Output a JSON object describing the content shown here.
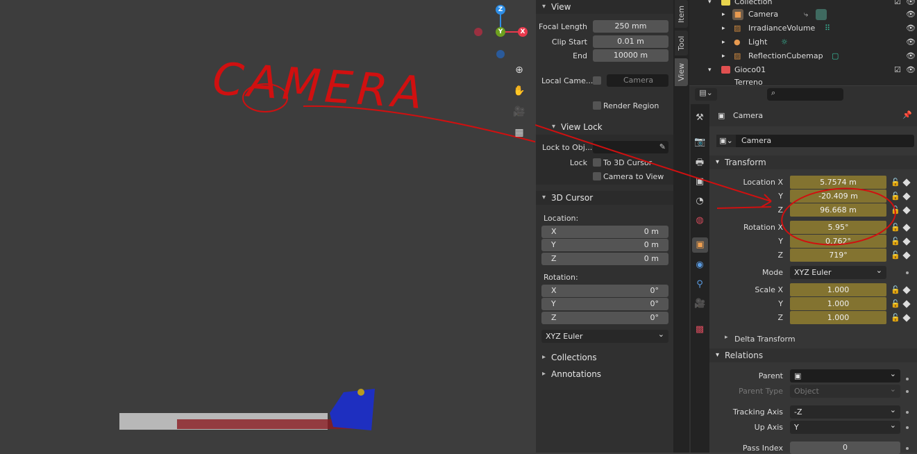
{
  "viewport": {
    "annotation_text": "CAMERA",
    "annotation_color": "#d01010",
    "axes": {
      "z": "Z",
      "y": "Y",
      "x": "X"
    },
    "colors": {
      "x": "#e8394c",
      "y": "#6ea01f",
      "z": "#2e8ee6"
    }
  },
  "npanel": {
    "tabs": [
      "Item",
      "Tool",
      "View"
    ],
    "active_tab": "View",
    "view": {
      "title": "View",
      "focal_length_label": "Focal Length",
      "focal_length": "250 mm",
      "clip_start_label": "Clip Start",
      "clip_start": "0.01 m",
      "end_label": "End",
      "end": "10000 m",
      "local_camera_label": "Local Came...",
      "local_camera_value": "Camera",
      "render_region": "Render Region"
    },
    "view_lock": {
      "title": "View Lock",
      "lock_to_obj_label": "Lock to Obj...",
      "lock_label": "Lock",
      "to_3d_cursor": "To 3D Cursor",
      "camera_to_view": "Camera to View"
    },
    "cursor": {
      "title": "3D Cursor",
      "location_label": "Location:",
      "loc": [
        {
          "axis": "X",
          "value": "0 m"
        },
        {
          "axis": "Y",
          "value": "0 m"
        },
        {
          "axis": "Z",
          "value": "0 m"
        }
      ],
      "rotation_label": "Rotation:",
      "rot": [
        {
          "axis": "X",
          "value": "0°"
        },
        {
          "axis": "Y",
          "value": "0°"
        },
        {
          "axis": "Z",
          "value": "0°"
        }
      ],
      "mode": "XYZ Euler"
    },
    "collections": "Collections",
    "annotations": "Annotations"
  },
  "outliner": {
    "rows": [
      {
        "name": "Collection"
      },
      {
        "name": "Camera"
      },
      {
        "name": "IrradianceVolume"
      },
      {
        "name": "Light"
      },
      {
        "name": "ReflectionCubemap"
      },
      {
        "name": "Gioco01"
      },
      {
        "name": "Terreno"
      }
    ]
  },
  "properties": {
    "object_name": "Camera",
    "datablock": "Camera",
    "transform": {
      "title": "Transform",
      "location_x_label": "Location X",
      "y": "Y",
      "z": "Z",
      "location": [
        "5.7574 m",
        "-20.409 m",
        "96.668 m"
      ],
      "rotation_x_label": "Rotation X",
      "rotation": [
        "5.95°",
        "0.762°",
        "719°"
      ],
      "mode_label": "Mode",
      "mode": "XYZ Euler",
      "scale_x_label": "Scale X",
      "scale": [
        "1.000",
        "1.000",
        "1.000"
      ]
    },
    "delta_transform": "Delta Transform",
    "relations": {
      "title": "Relations",
      "parent_label": "Parent",
      "parent_type_label": "Parent Type",
      "parent_type": "Object",
      "tracking_axis_label": "Tracking Axis",
      "tracking_axis": "-Z",
      "up_axis_label": "Up Axis",
      "up_axis": "Y",
      "pass_index_label": "Pass Index",
      "pass_index": "0"
    },
    "field_color": "#837330"
  }
}
